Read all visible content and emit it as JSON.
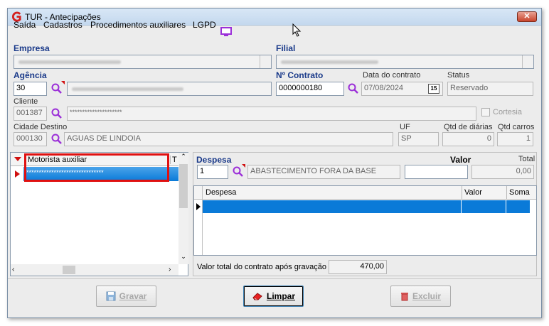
{
  "window": {
    "title": "TUR - Antecipações"
  },
  "menu": [
    "Saída",
    "Cadastros",
    "Procedimentos auxiliares",
    "LGPD"
  ],
  "form": {
    "empresa_label": "Empresa",
    "filial_label": "Filial",
    "agencia_label": "Agência",
    "agencia_code": "30",
    "contrato_label": "Nº Contrato",
    "contrato_value": "0000000180",
    "data_contrato_label": "Data do contrato",
    "data_contrato_value": "07/08/2024",
    "calendar_label": "15",
    "status_label": "Status",
    "status_value": "Reservado",
    "cliente_label": "Cliente",
    "cliente_code": "001387",
    "cliente_name": "*********************",
    "cortesia_label": "Cortesia",
    "cidade_label": "Cidade Destino",
    "cidade_code": "000130",
    "cidade_name": "AGUAS DE LINDOIA",
    "uf_label": "UF",
    "uf_value": "SP",
    "qtd_diarias_label": "Qtd de diárias",
    "qtd_diarias_value": "0",
    "qtd_carros_label": "Qtd carros",
    "qtd_carros_value": "1"
  },
  "motorista": {
    "column": "Motorista auxiliar",
    "column2": "T",
    "row": "*******************************"
  },
  "despesa": {
    "label": "Despesa",
    "valor_label": "Valor",
    "total_label": "Total",
    "code": "1",
    "name": "ABASTECIMENTO FORA DA BASE",
    "valor": "",
    "total": "0,00",
    "grid_columns": [
      "Despesa",
      "Valor",
      "Soma"
    ],
    "footer_label": "Valor total do contrato após gravação",
    "footer_value": "470,00"
  },
  "buttons": {
    "gravar": "Gravar",
    "limpar": "Limpar",
    "excluir": "Excluir"
  },
  "colors": {
    "accent": "#1a3a8a",
    "selection": "#0a7ad8",
    "highlight": "#e01010"
  }
}
